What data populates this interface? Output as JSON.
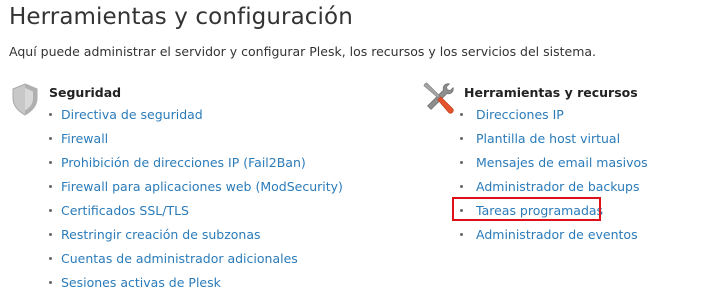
{
  "page": {
    "title": "Herramientas y configuración",
    "description": "Aquí puede administrar el servidor y configurar Plesk, los recursos y los servicios del sistema."
  },
  "sections": [
    {
      "title": "Seguridad",
      "icon": "shield-icon",
      "links": [
        {
          "label": "Directiva de seguridad"
        },
        {
          "label": "Firewall"
        },
        {
          "label": "Prohibición de direcciones IP (Fail2Ban)"
        },
        {
          "label": "Firewall para aplicaciones web (ModSecurity)"
        },
        {
          "label": "Certificados SSL/TLS"
        },
        {
          "label": "Restringir creación de subzonas"
        },
        {
          "label": "Cuentas de administrador adicionales"
        },
        {
          "label": "Sesiones activas de Plesk"
        }
      ]
    },
    {
      "title": "Herramientas y recursos",
      "icon": "wrench-screwdriver-icon",
      "links": [
        {
          "label": "Direcciones IP"
        },
        {
          "label": "Plantilla de host virtual"
        },
        {
          "label": "Mensajes de email masivos"
        },
        {
          "label": "Administrador de backups"
        },
        {
          "label": "Tareas programadas",
          "highlighted": true
        },
        {
          "label": "Administrador de eventos"
        }
      ]
    }
  ],
  "colors": {
    "link": "#2b7bb9",
    "highlight": "#e0101a",
    "tool_handle": "#e5532d"
  }
}
